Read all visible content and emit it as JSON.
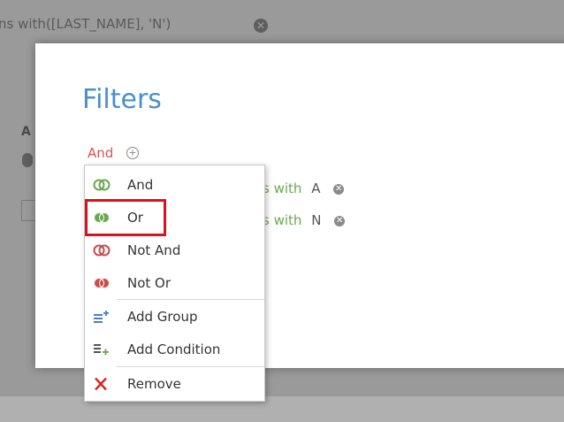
{
  "background": {
    "filter_bar_text": "ns with([LAST_NAME], 'N')",
    "panel_letter": "A"
  },
  "modal": {
    "title": "Filters",
    "group_operator": "And",
    "conditions": [
      {
        "operator_partial": "s with",
        "value": "A"
      },
      {
        "operator_partial": "s with",
        "value": "N"
      }
    ]
  },
  "menu": {
    "items": [
      {
        "label": "And",
        "icon": "and-icon"
      },
      {
        "label": "Or",
        "icon": "or-icon",
        "highlighted": true
      },
      {
        "label": "Not And",
        "icon": "not-and-icon"
      },
      {
        "label": "Not Or",
        "icon": "not-or-icon"
      },
      {
        "label": "Add Group",
        "icon": "add-group-icon"
      },
      {
        "label": "Add Condition",
        "icon": "add-condition-icon"
      },
      {
        "label": "Remove",
        "icon": "remove-icon"
      }
    ]
  },
  "colors": {
    "title": "#4a90c8",
    "operator": "#d9534f",
    "condition_op": "#6aa84f",
    "highlight": "#e0101a",
    "green_icon": "#6aa84f",
    "red_icon": "#cc4b4b"
  }
}
